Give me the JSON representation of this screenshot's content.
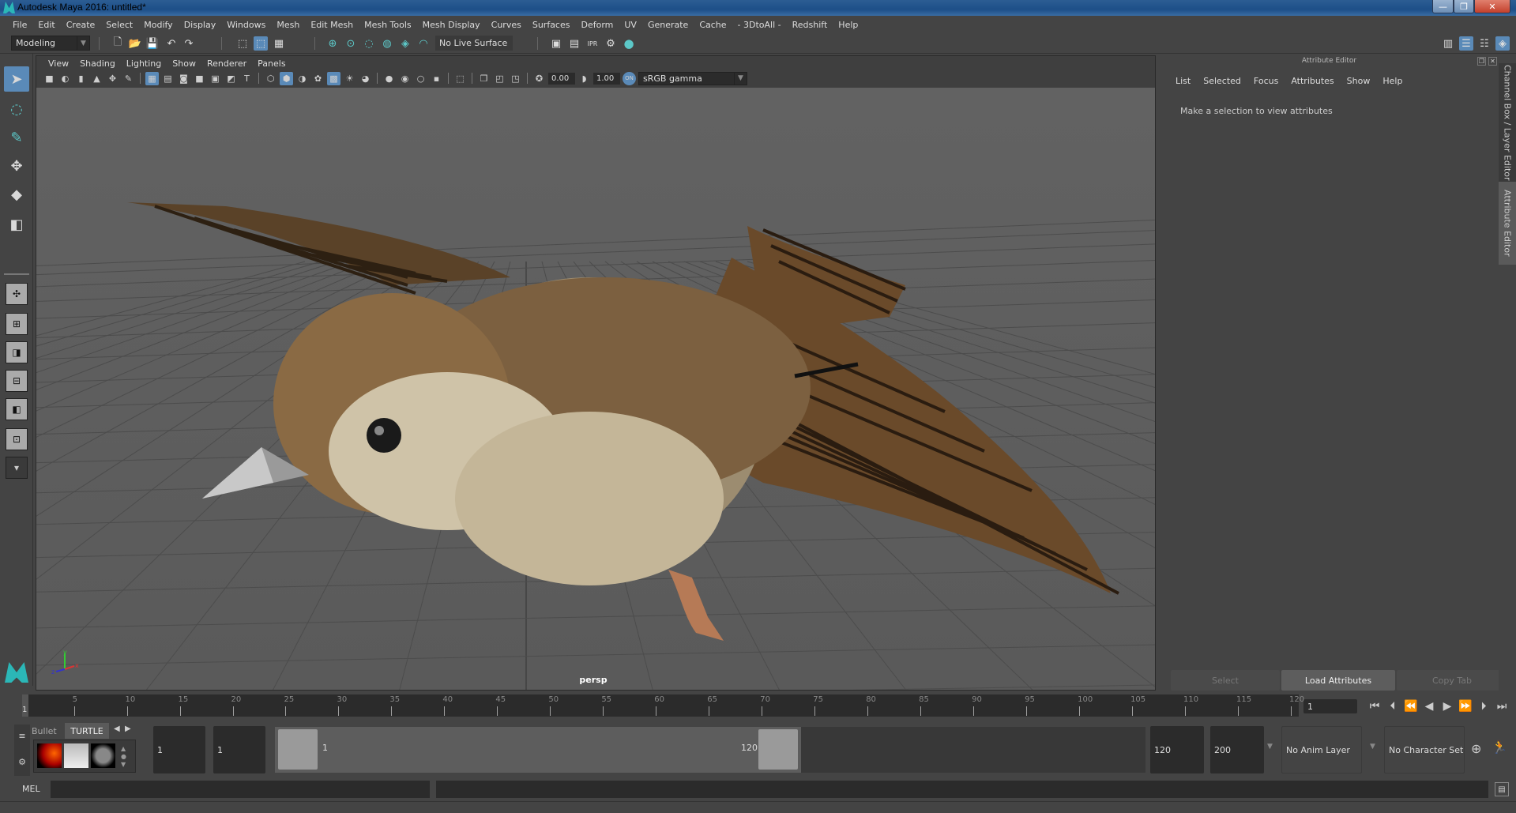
{
  "window": {
    "title": "Autodesk Maya 2016: untitled*",
    "controls": {
      "minimize": "—",
      "restore": "❐",
      "close": "✕"
    }
  },
  "menubar": [
    "File",
    "Edit",
    "Create",
    "Select",
    "Modify",
    "Display",
    "Windows",
    "Mesh",
    "Edit Mesh",
    "Mesh Tools",
    "Mesh Display",
    "Curves",
    "Surfaces",
    "Deform",
    "UV",
    "Generate",
    "Cache",
    "- 3DtoAll -",
    "Redshift",
    "Help"
  ],
  "statusline": {
    "menuset": "Modeling",
    "live_surface": "No Live Surface"
  },
  "viewport": {
    "menu": [
      "View",
      "Shading",
      "Lighting",
      "Show",
      "Renderer",
      "Panels"
    ],
    "exposure": "0.00",
    "gamma": "1.00",
    "color_space": "sRGB gamma",
    "camera_label": "persp",
    "axis": {
      "x": "x",
      "y": "y",
      "z": "z"
    }
  },
  "attribute_editor": {
    "title": "Attribute Editor",
    "menu": [
      "List",
      "Selected",
      "Focus",
      "Attributes",
      "Show",
      "Help"
    ],
    "message": "Make a selection to view attributes",
    "buttons": {
      "select": "Select",
      "load": "Load Attributes",
      "copy": "Copy Tab"
    }
  },
  "side_tabs": {
    "channel_box": "Channel Box / Layer Editor",
    "attribute_editor": "Attribute Editor"
  },
  "timeline": {
    "start_marker": "1",
    "ticks": [
      5,
      10,
      15,
      20,
      25,
      30,
      35,
      40,
      45,
      50,
      55,
      60,
      65,
      70,
      75,
      80,
      85,
      90,
      95,
      100,
      105,
      110,
      115,
      120
    ],
    "range_min": 1,
    "range_max": 120,
    "current_frame": "1"
  },
  "shelf": {
    "tabs": [
      "Bullet",
      "TURTLE"
    ],
    "active_tab": "TURTLE"
  },
  "range": {
    "anim_start": "1",
    "play_start": "1",
    "slider_start_label": "1",
    "slider_end_label": "120",
    "play_end": "120",
    "anim_end": "200",
    "anim_layer": "No Anim Layer",
    "character_set": "No Character Set"
  },
  "command_line": {
    "label": "MEL",
    "value": ""
  },
  "colors": {
    "accent": "#5a8ab8",
    "teal": "#2bb7b7",
    "panel": "#444444",
    "field": "#2b2b2b",
    "viewport": "#5e5e5e"
  }
}
